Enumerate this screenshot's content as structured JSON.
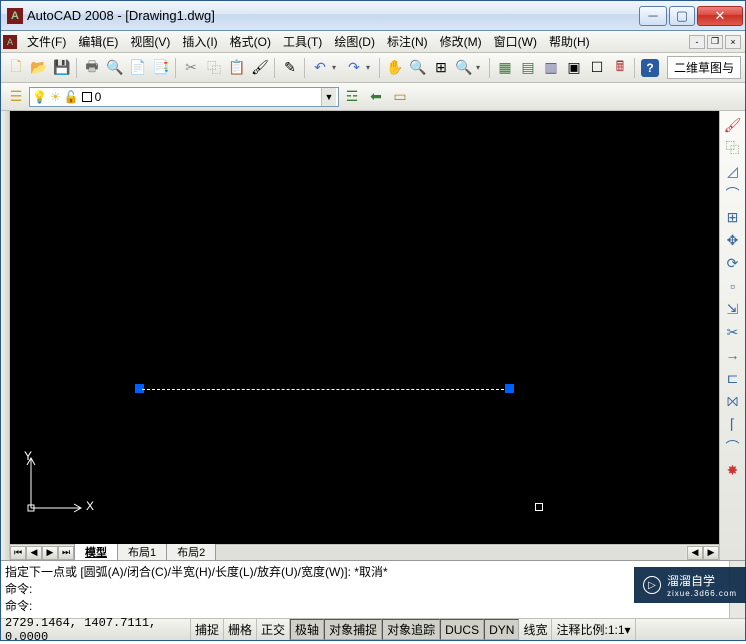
{
  "title": "AutoCAD 2008 - [Drawing1.dwg]",
  "menus": [
    "文件(F)",
    "编辑(E)",
    "视图(V)",
    "插入(I)",
    "格式(O)",
    "工具(T)",
    "绘图(D)",
    "标注(N)",
    "修改(M)",
    "窗口(W)",
    "帮助(H)"
  ],
  "workspace_label": "二维草图与",
  "layer": {
    "name": "0"
  },
  "tabs": {
    "model": "模型",
    "layout1": "布局1",
    "layout2": "布局2"
  },
  "ucs": {
    "x": "X",
    "y": "Y"
  },
  "command": {
    "line1": "指定下一点或 [圆弧(A)/闭合(C)/半宽(H)/长度(L)/放弃(U)/宽度(W)]: *取消*",
    "line2": "命令:",
    "line3": "命令:"
  },
  "status": {
    "coords": "2729.1464, 1407.7111, 0.0000",
    "snap": "捕捉",
    "grid": "栅格",
    "ortho": "正交",
    "polar": "极轴",
    "osnap": "对象捕捉",
    "otrack": "对象追踪",
    "ducs": "DUCS",
    "dyn": "DYN",
    "lwt": "线宽",
    "annoscale_label": "注释比例:",
    "annoscale_value": "1:1"
  },
  "watermark": {
    "text": "溜溜自学",
    "sub": "zixue.3d66.com"
  }
}
